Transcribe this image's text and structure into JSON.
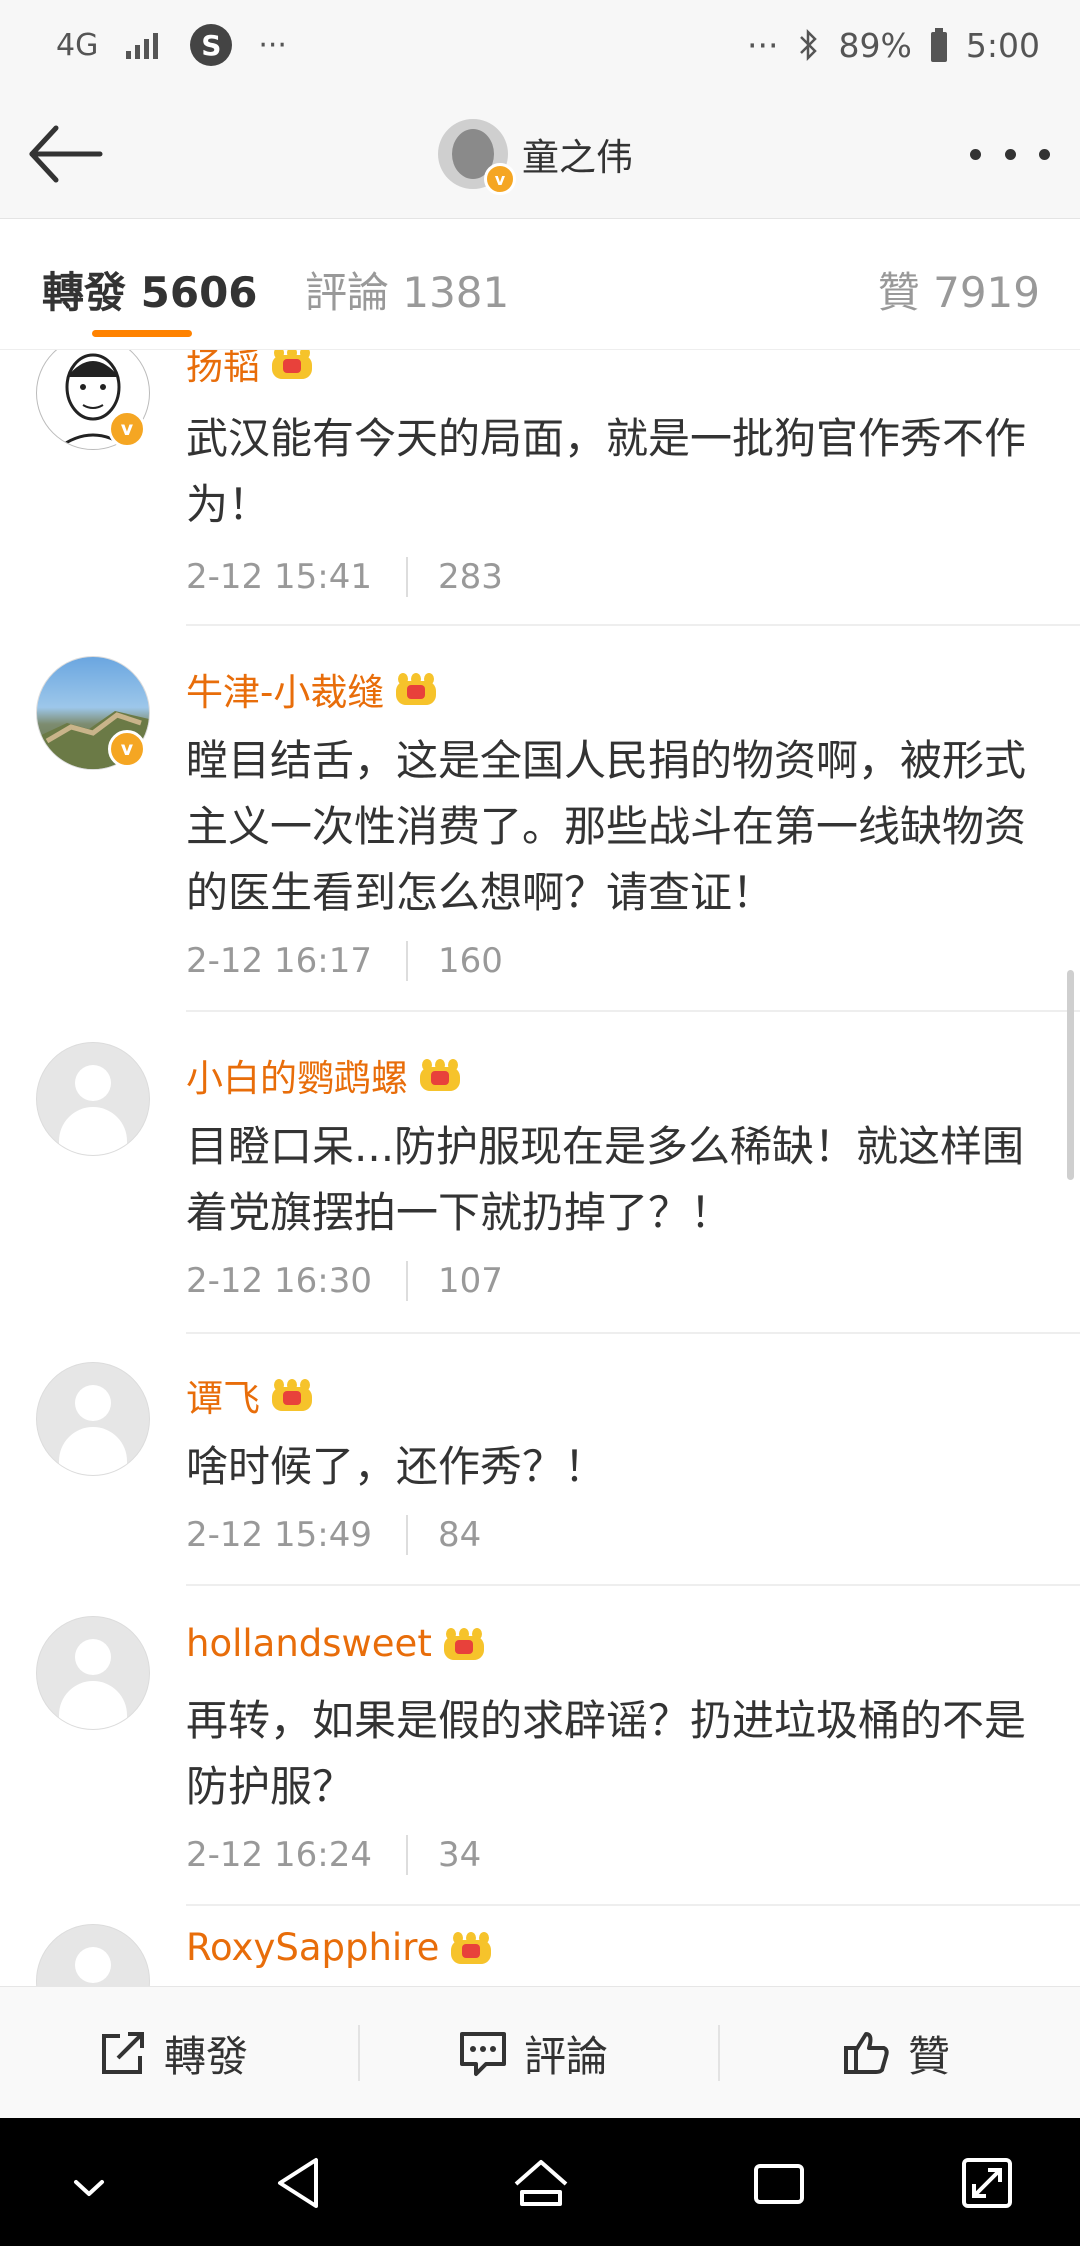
{
  "status_bar": {
    "network": "4G",
    "left_dots": "···",
    "right_dots": "···",
    "battery": "89%",
    "time": "5:00"
  },
  "nav": {
    "title": "童之伟"
  },
  "tabs": {
    "repost": "轉發 5606",
    "comment": "評論 1381",
    "like": "贊 7919"
  },
  "items": [
    {
      "name": "扬韬",
      "text": "武汉能有今天的局面，就是一批狗官作秀不作为！",
      "time": "2-12 15:41",
      "likes": "283"
    },
    {
      "name": "牛津-小裁缝",
      "text": "瞠目结舌，这是全国人民捐的物资啊，被形式主义一次性消费了。那些战斗在第一线缺物资的医生看到怎么想啊？请查证！",
      "time": "2-12 16:17",
      "likes": "160"
    },
    {
      "name": "小白的鹦鹉螺",
      "text": "目瞪口呆...防护服现在是多么稀缺！就这样围着党旗摆拍一下就扔掉了？！",
      "time": "2-12 16:30",
      "likes": "107"
    },
    {
      "name": "谭飞",
      "text": "啥时候了，还作秀？！",
      "time": "2-12 15:49",
      "likes": "84"
    },
    {
      "name": "hollandsweet",
      "text": "再转，如果是假的求辟谣？扔进垃圾桶的不是防护服？",
      "time": "2-12 16:24",
      "likes": "34"
    },
    {
      "name": "RoxySapphire"
    }
  ],
  "actions": {
    "repost": "轉發",
    "comment": "評論",
    "like": "贊"
  },
  "colors": {
    "accent": "#ff8200",
    "username": "#e86d0a",
    "meta": "#999999"
  },
  "icons": [
    "back-arrow-icon",
    "more-icon",
    "crown-icon",
    "verified-icon",
    "share-icon",
    "comment-icon",
    "thumbs-up-icon"
  ]
}
